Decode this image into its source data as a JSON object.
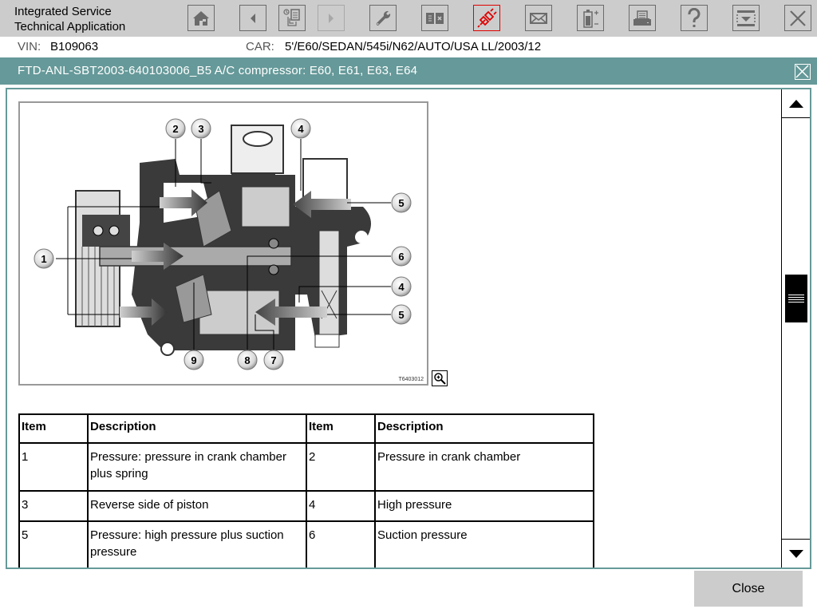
{
  "app": {
    "title_line1": "Integrated Service",
    "title_line2": "Technical Application"
  },
  "toolbar": {
    "buttons": [
      {
        "name": "home",
        "icon": "home-icon",
        "state": "normal"
      },
      {
        "name": "back",
        "icon": "arrow-left-icon",
        "state": "normal"
      },
      {
        "name": "history",
        "icon": "history-documents-icon",
        "state": "normal"
      },
      {
        "name": "forward",
        "icon": "arrow-right-icon",
        "state": "disabled"
      },
      {
        "name": "service",
        "icon": "wrench-icon",
        "state": "normal"
      },
      {
        "name": "split-view",
        "icon": "document-close-icon",
        "state": "normal"
      },
      {
        "name": "connection",
        "icon": "plug-connector-icon",
        "state": "active"
      },
      {
        "name": "messages",
        "icon": "envelope-icon",
        "state": "normal"
      },
      {
        "name": "battery",
        "icon": "battery-icon",
        "state": "normal"
      },
      {
        "name": "print",
        "icon": "printer-icon",
        "state": "normal"
      },
      {
        "name": "help",
        "icon": "question-mark-icon",
        "state": "normal"
      },
      {
        "name": "minimize",
        "icon": "panel-down-icon",
        "state": "normal"
      },
      {
        "name": "exit",
        "icon": "close-icon",
        "state": "normal"
      }
    ],
    "active_color": "#e00000"
  },
  "vehicle": {
    "vin_label": "VIN:",
    "vin": "B109063",
    "car_label": "CAR:",
    "car": "5'/E60/SEDAN/545i/N62/AUTO/USA LL/2003/12"
  },
  "document": {
    "title": "FTD-ANL-SBT2003-640103006_B5 A/C compressor: E60, E61, E63, E64",
    "figure_code": "T6403012",
    "callouts": [
      "1",
      "2",
      "3",
      "4",
      "5",
      "6",
      "7",
      "8",
      "9"
    ],
    "table": {
      "headers": [
        "Item",
        "Description",
        "Item",
        "Description"
      ],
      "rows": [
        {
          "item1": "1",
          "desc1": "Pressure: pressure in crank chamber plus spring",
          "item2": "2",
          "desc2": "Pressure in crank chamber"
        },
        {
          "item1": "3",
          "desc1": "Reverse side of piston",
          "item2": "4",
          "desc2": "High pressure"
        },
        {
          "item1": "5",
          "desc1": "Pressure: high pressure plus suction pressure",
          "item2": "6",
          "desc2": "Suction pressure"
        }
      ]
    }
  },
  "scroll": {
    "position_fraction": 0.42
  },
  "footer": {
    "close_label": "Close"
  },
  "colors": {
    "toolbar_bg": "#cccccc",
    "titlebar_bg": "#669999",
    "icon_gray": "#6b6b6b"
  }
}
